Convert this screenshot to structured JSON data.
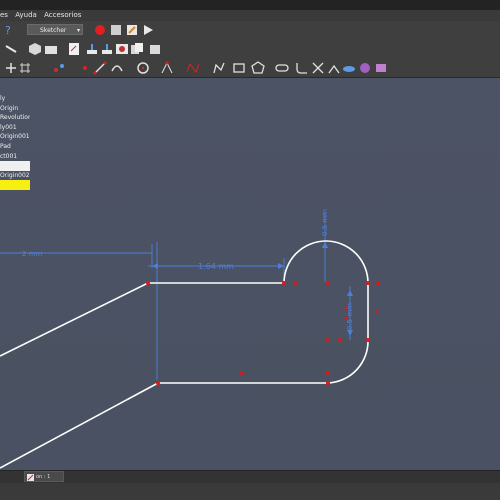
{
  "menu": {
    "items": [
      "es",
      "Ayuda",
      "Accesorios"
    ]
  },
  "toolbar": {
    "workbench": "Sketcher",
    "icons": [
      "help-icon",
      "record-macro-icon",
      "stop-macro-icon",
      "edit-macro-icon",
      "run-macro-icon"
    ]
  },
  "tree": {
    "items": [
      "ly",
      "Origin",
      "Revolution",
      "ly001",
      "Origin001",
      "Pad",
      "ct001",
      "",
      "Origin002",
      ""
    ]
  },
  "dimensions": {
    "top_horizontal": "1.64 mm",
    "left_horizontal": "2 mm",
    "vertical_top": "0.5 mm",
    "vertical_mid": "0.5 mm"
  },
  "tab": {
    "label": "on : 1"
  },
  "colors": {
    "sketch_line": "#ffffff",
    "dimension": "#4d7fd6",
    "constraint": "#d42020",
    "viewport": "#4a5161"
  }
}
